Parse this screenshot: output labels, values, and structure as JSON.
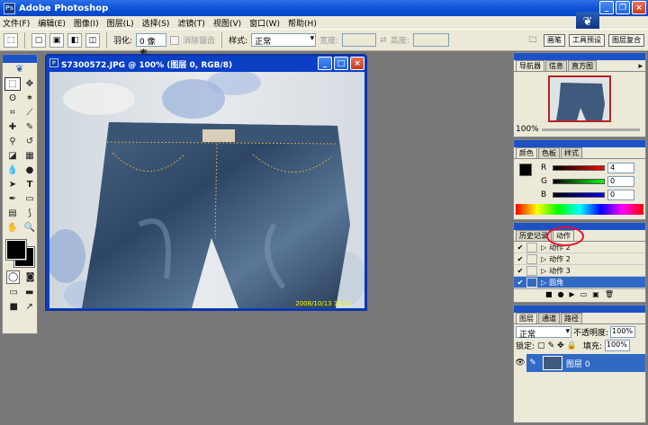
{
  "app": {
    "title": "Adobe Photoshop",
    "logo_text": "Ps"
  },
  "menu": [
    "文件(F)",
    "编辑(E)",
    "图像(I)",
    "图层(L)",
    "选择(S)",
    "滤镜(T)",
    "视图(V)",
    "窗口(W)",
    "帮助(H)"
  ],
  "options": {
    "feather_label": "羽化:",
    "feather_value": "0 像素",
    "antialias_label": "消除锯齿",
    "style_label": "样式:",
    "style_value": "正常",
    "width_label": "宽度:",
    "height_label": "高度:",
    "well_tabs": [
      "画笔",
      "工具预设",
      "图层复合"
    ]
  },
  "document": {
    "title": "S7300572.JPG @ 100% (图层 0, RGB/8)",
    "timestamp": "2008/10/13 15:31"
  },
  "navigator": {
    "tabs": [
      "导航器",
      "信息",
      "直方图"
    ],
    "zoom": "100%"
  },
  "color": {
    "tabs": [
      "颜色",
      "色板",
      "样式"
    ],
    "channels": [
      {
        "label": "R",
        "value": "4"
      },
      {
        "label": "G",
        "value": "0"
      },
      {
        "label": "B",
        "value": "0"
      }
    ]
  },
  "actions": {
    "tabs": [
      "历史记录",
      "动作"
    ],
    "items": [
      {
        "label": "动作 2"
      },
      {
        "label": "动作 2"
      },
      {
        "label": "动作 3"
      },
      {
        "label": "圆角"
      }
    ]
  },
  "layers": {
    "tabs": [
      "图层",
      "通道",
      "路径"
    ],
    "blend_mode": "正常",
    "opacity_label": "不透明度:",
    "opacity_value": "100%",
    "lock_label": "锁定:",
    "fill_label": "填充:",
    "fill_value": "100%",
    "layer_name": "图层 0"
  },
  "colors": {
    "accent": "#1d52c7",
    "selection": "#316ac5",
    "annotation": "#e8102a"
  }
}
